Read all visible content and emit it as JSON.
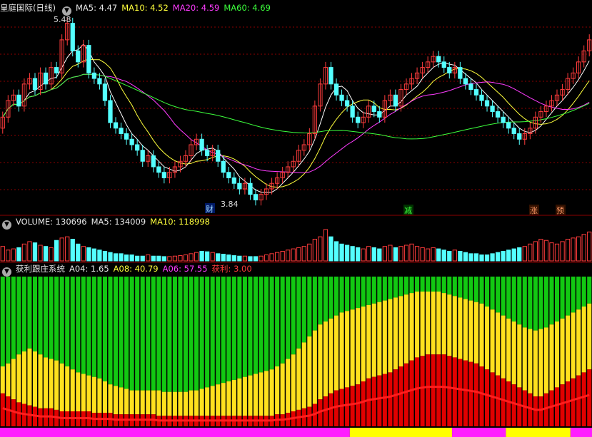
{
  "header": {
    "stock_title": "皇庭国际(日线)",
    "ma5": "MA5: 4.47",
    "ma10": "MA10: 4.52",
    "ma20": "MA20: 4.59",
    "ma60": "MA60: 4.69",
    "volume": "VOLUME: 130696",
    "vol_ma5": "MA5: 134009",
    "vol_ma10": "MA10: 118998",
    "indicator_name": "获利跟庄系统",
    "a04": "A04: 1.65",
    "a08": "A08: 40.79",
    "a06": "A06: 57.55",
    "profit": "获利: 3.00"
  },
  "price_annotations": {
    "high": "5.48",
    "low": "3.84"
  },
  "markers": {
    "m1": "财",
    "m2": "减",
    "m3": "涨",
    "m4": "预"
  },
  "colors": {
    "up": "#ff3c3c",
    "down": "#54ffff",
    "ma5": "#ffffff",
    "ma10": "#ffff3c",
    "ma20": "#ff3cff",
    "ma60": "#3cff3c",
    "grid": "#8b0000",
    "band_green": "#12c812",
    "band_yellow": "#ffe11e",
    "band_red": "#e10000",
    "strip_magenta": "#ff1eff",
    "strip_yellow": "#ffff00"
  },
  "chart_data": [
    {
      "type": "candlestick",
      "close": [
        4.6,
        4.75,
        4.8,
        4.7,
        4.9,
        4.95,
        4.85,
        5.0,
        4.9,
        5.05,
        5.0,
        5.3,
        5.45,
        5.2,
        5.1,
        5.25,
        5.0,
        4.95,
        4.9,
        4.75,
        4.55,
        4.5,
        4.45,
        4.4,
        4.35,
        4.3,
        4.2,
        4.25,
        4.15,
        4.1,
        4.05,
        4.1,
        4.15,
        4.2,
        4.25,
        4.35,
        4.4,
        4.3,
        4.25,
        4.3,
        4.2,
        4.1,
        4.05,
        4.0,
        3.95,
        4.0,
        3.9,
        3.85,
        3.9,
        3.95,
        4.0,
        4.05,
        4.1,
        4.15,
        4.2,
        4.3,
        4.35,
        4.45,
        4.7,
        4.9,
        5.05,
        4.9,
        4.8,
        4.75,
        4.7,
        4.6,
        4.55,
        4.6,
        4.7,
        4.65,
        4.6,
        4.75,
        4.8,
        4.7,
        4.85,
        4.9,
        4.95,
        5.0,
        5.05,
        5.1,
        5.15,
        5.1,
        5.05,
        5.0,
        5.05,
        4.95,
        4.9,
        4.85,
        4.8,
        4.75,
        4.7,
        4.65,
        4.6,
        4.55,
        4.5,
        4.45,
        4.4,
        4.45,
        4.5,
        4.6,
        4.65,
        4.7,
        4.75,
        4.8,
        4.85,
        4.95,
        5.0,
        5.1,
        5.2,
        5.3
      ],
      "open": [
        4.5,
        4.6,
        4.75,
        4.8,
        4.7,
        4.9,
        4.95,
        4.85,
        5.0,
        4.9,
        5.05,
        5.0,
        5.3,
        5.45,
        5.2,
        5.1,
        5.25,
        5.0,
        4.95,
        4.9,
        4.75,
        4.55,
        4.5,
        4.45,
        4.4,
        4.35,
        4.3,
        4.2,
        4.25,
        4.15,
        4.1,
        4.05,
        4.1,
        4.15,
        4.2,
        4.25,
        4.35,
        4.4,
        4.3,
        4.25,
        4.3,
        4.2,
        4.1,
        4.05,
        4.0,
        3.95,
        4.0,
        3.9,
        3.85,
        3.9,
        3.95,
        4.0,
        4.05,
        4.1,
        4.15,
        4.2,
        4.3,
        4.35,
        4.45,
        4.7,
        4.9,
        5.05,
        4.9,
        4.8,
        4.75,
        4.7,
        4.6,
        4.55,
        4.6,
        4.7,
        4.65,
        4.6,
        4.75,
        4.8,
        4.7,
        4.85,
        4.9,
        4.95,
        5.0,
        5.05,
        5.1,
        5.15,
        5.1,
        5.05,
        5.0,
        5.05,
        4.95,
        4.9,
        4.85,
        4.8,
        4.75,
        4.7,
        4.65,
        4.6,
        4.55,
        4.5,
        4.45,
        4.4,
        4.45,
        4.5,
        4.6,
        4.65,
        4.7,
        4.75,
        4.8,
        4.85,
        4.95,
        5.0,
        5.1,
        5.2
      ],
      "high_label": "5.48",
      "low_label": "3.84",
      "ma_lines": [
        "MA5",
        "MA10",
        "MA20",
        "MA60"
      ]
    },
    {
      "type": "bar",
      "name": "VOLUME",
      "values": [
        60,
        45,
        50,
        55,
        70,
        80,
        75,
        65,
        60,
        55,
        85,
        95,
        100,
        90,
        70,
        60,
        55,
        50,
        45,
        40,
        35,
        30,
        30,
        25,
        25,
        20,
        20,
        25,
        20,
        20,
        18,
        18,
        20,
        22,
        25,
        30,
        35,
        40,
        38,
        35,
        30,
        28,
        25,
        22,
        20,
        20,
        18,
        18,
        20,
        25,
        30,
        35,
        40,
        45,
        50,
        55,
        60,
        70,
        90,
        100,
        130,
        100,
        80,
        70,
        65,
        60,
        55,
        50,
        60,
        55,
        50,
        60,
        65,
        55,
        60,
        65,
        70,
        60,
        55,
        50,
        55,
        50,
        45,
        40,
        45,
        40,
        35,
        30,
        30,
        25,
        25,
        30,
        35,
        40,
        45,
        50,
        55,
        60,
        70,
        80,
        90,
        85,
        75,
        70,
        80,
        90,
        95,
        100,
        110,
        120
      ]
    },
    {
      "type": "bar",
      "name": "获利跟庄系统",
      "red": [
        22,
        20,
        18,
        16,
        15,
        14,
        13,
        12,
        12,
        12,
        11,
        10,
        10,
        10,
        10,
        10,
        10,
        9,
        9,
        9,
        9,
        8,
        8,
        8,
        8,
        8,
        8,
        8,
        8,
        7,
        7,
        7,
        7,
        7,
        7,
        7,
        7,
        7,
        7,
        7,
        7,
        7,
        7,
        7,
        7,
        7,
        7,
        7,
        7,
        7,
        7,
        8,
        8,
        9,
        10,
        11,
        12,
        13,
        15,
        18,
        20,
        22,
        24,
        25,
        26,
        27,
        28,
        30,
        32,
        33,
        34,
        35,
        36,
        38,
        40,
        42,
        44,
        46,
        47,
        48,
        48,
        48,
        48,
        47,
        46,
        45,
        44,
        43,
        42,
        40,
        38,
        36,
        34,
        32,
        30,
        28,
        26,
        24,
        22,
        20,
        20,
        22,
        24,
        26,
        28,
        30,
        32,
        34,
        36,
        38
      ],
      "yellow": [
        40,
        42,
        45,
        48,
        50,
        52,
        50,
        48,
        46,
        45,
        44,
        42,
        40,
        38,
        36,
        35,
        34,
        33,
        32,
        30,
        28,
        27,
        26,
        25,
        24,
        24,
        24,
        24,
        24,
        24,
        23,
        23,
        23,
        23,
        23,
        24,
        24,
        25,
        26,
        27,
        28,
        29,
        30,
        31,
        32,
        33,
        34,
        35,
        36,
        37,
        38,
        40,
        42,
        45,
        48,
        52,
        56,
        60,
        64,
        68,
        70,
        72,
        74,
        76,
        77,
        78,
        79,
        80,
        81,
        82,
        83,
        84,
        85,
        86,
        87,
        88,
        89,
        90,
        90,
        90,
        90,
        90,
        89,
        88,
        87,
        86,
        85,
        84,
        83,
        82,
        80,
        78,
        76,
        74,
        72,
        70,
        68,
        66,
        65,
        64,
        65,
        66,
        68,
        70,
        72,
        74,
        76,
        78,
        80,
        82
      ]
    }
  ]
}
